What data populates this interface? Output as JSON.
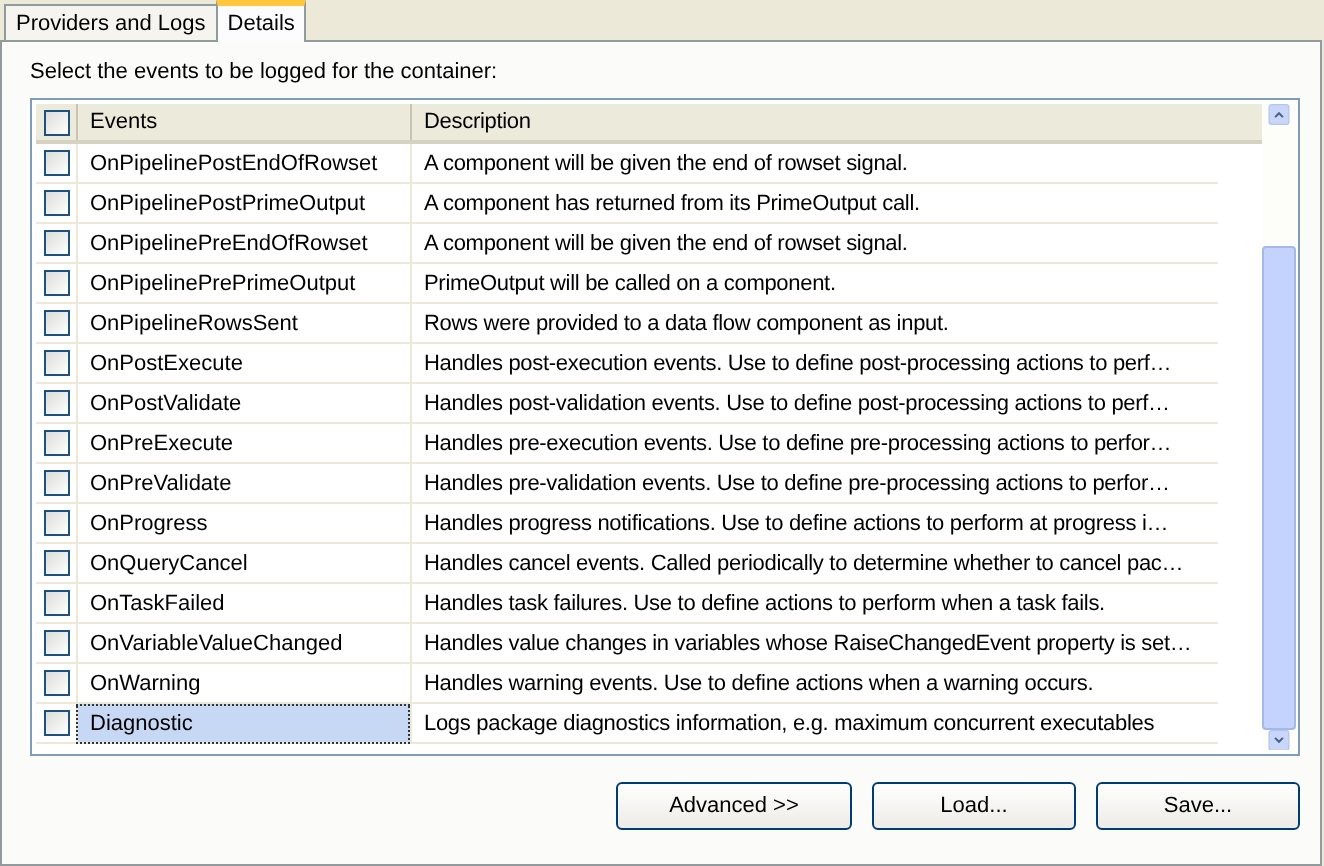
{
  "tabs": [
    {
      "label": "Providers and Logs",
      "selected": false
    },
    {
      "label": "Details",
      "selected": true
    }
  ],
  "instruction": "Select the events to be logged for the container:",
  "table": {
    "header_checked": false,
    "columns": [
      "Events",
      "Description"
    ],
    "rows": [
      {
        "checked": false,
        "selected": false,
        "event": "OnPipelinePostEndOfRowset",
        "description": "A component will be given the end of rowset signal."
      },
      {
        "checked": false,
        "selected": false,
        "event": "OnPipelinePostPrimeOutput",
        "description": "A component has returned from its PrimeOutput call."
      },
      {
        "checked": false,
        "selected": false,
        "event": "OnPipelinePreEndOfRowset",
        "description": "A component will be given the end of rowset signal."
      },
      {
        "checked": false,
        "selected": false,
        "event": "OnPipelinePrePrimeOutput",
        "description": "PrimeOutput will be called on a component."
      },
      {
        "checked": false,
        "selected": false,
        "event": "OnPipelineRowsSent",
        "description": "Rows were provided to a data flow component as input."
      },
      {
        "checked": false,
        "selected": false,
        "event": "OnPostExecute",
        "description": "Handles post-execution events. Use to define post-processing actions to perf…"
      },
      {
        "checked": false,
        "selected": false,
        "event": "OnPostValidate",
        "description": "Handles post-validation events. Use to define post-processing actions to perf…"
      },
      {
        "checked": false,
        "selected": false,
        "event": "OnPreExecute",
        "description": "Handles pre-execution events. Use to define pre-processing actions to perfor…"
      },
      {
        "checked": false,
        "selected": false,
        "event": "OnPreValidate",
        "description": "Handles pre-validation events. Use to define pre-processing actions to perfor…"
      },
      {
        "checked": false,
        "selected": false,
        "event": "OnProgress",
        "description": "Handles progress notifications. Use to define actions to perform at progress i…"
      },
      {
        "checked": false,
        "selected": false,
        "event": "OnQueryCancel",
        "description": "Handles cancel events. Called periodically to determine whether to cancel pac…"
      },
      {
        "checked": false,
        "selected": false,
        "event": "OnTaskFailed",
        "description": "Handles task failures. Use to define actions to perform when a task fails."
      },
      {
        "checked": false,
        "selected": false,
        "event": "OnVariableValueChanged",
        "description": "Handles value changes in variables whose RaiseChangedEvent property is set…"
      },
      {
        "checked": false,
        "selected": false,
        "event": "OnWarning",
        "description": "Handles warning events. Use to define actions when a warning occurs."
      },
      {
        "checked": false,
        "selected": true,
        "event": "Diagnostic",
        "description": "Logs package diagnostics information, e.g. maximum concurrent executables"
      }
    ]
  },
  "buttons": [
    "Advanced >>",
    "Load...",
    "Save..."
  ]
}
